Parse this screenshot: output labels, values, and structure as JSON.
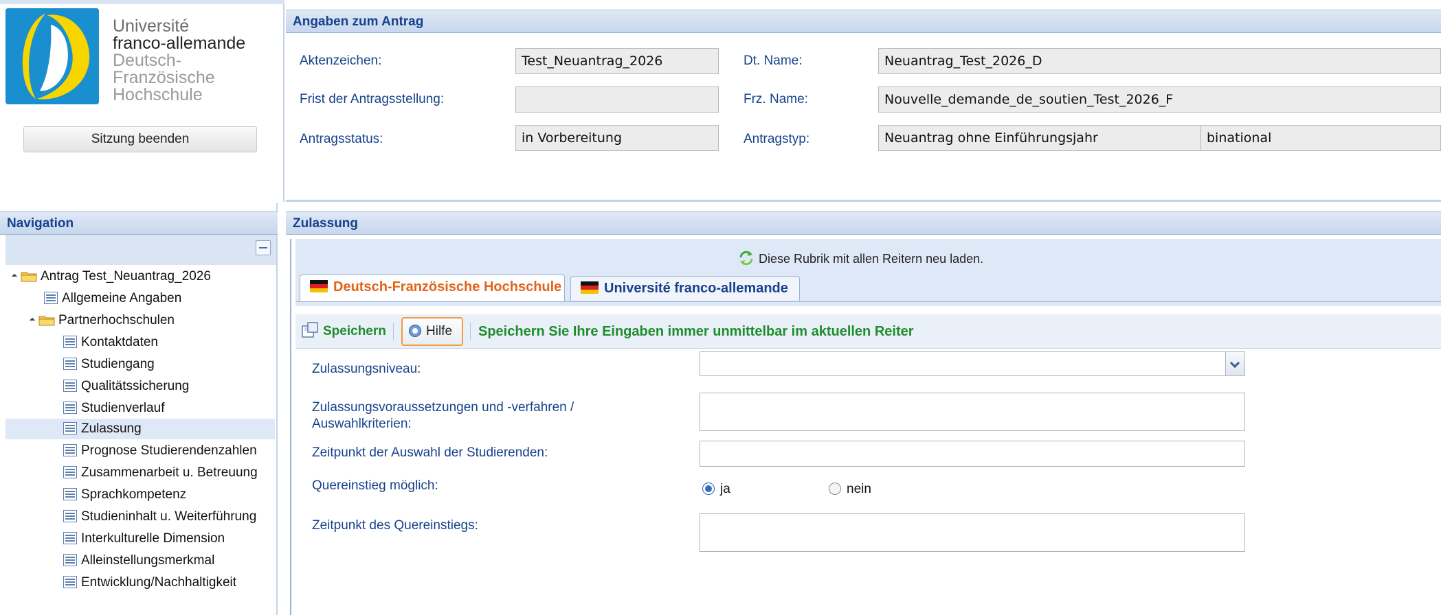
{
  "logo": {
    "line1": "Université",
    "line2": "franco-allemande",
    "line3": "Deutsch-Französische",
    "line4": "Hochschule"
  },
  "session": {
    "logout_label": "Sitzung beenden"
  },
  "antrag": {
    "header": "Angaben zum Antrag",
    "aktenzeichen_label": "Aktenzeichen:",
    "aktenzeichen_value": "Test_Neuantrag_2026",
    "frist_label": "Frist der Antragsstellung:",
    "frist_value": "",
    "status_label": "Antragsstatus:",
    "status_value": "in Vorbereitung",
    "dt_name_label": "Dt. Name:",
    "dt_name_value": "Neuantrag_Test_2026_D",
    "frz_name_label": "Frz. Name:",
    "frz_name_value": "Nouvelle_demande_de_soutien_Test_2026_F",
    "typ_label": "Antragstyp:",
    "typ_value": "Neuantrag ohne Einführungsjahr",
    "typ_value2": "binational"
  },
  "navigation": {
    "header": "Navigation",
    "root": "Antrag Test_Neuantrag_2026",
    "allgemein": "Allgemeine Angaben",
    "partner": "Partnerhochschulen",
    "items": [
      "Kontaktdaten",
      "Studiengang",
      "Qualitätssicherung",
      "Studienverlauf",
      "Zulassung",
      "Prognose Studierendenzahlen",
      "Zusammenarbeit u. Betreuung",
      "Sprachkompetenz",
      "Studieninhalt u. Weiterführung",
      "Interkulturelle Dimension",
      "Alleinstellungsmerkmal",
      "Entwicklung/Nachhaltigkeit"
    ],
    "selected": "Zulassung"
  },
  "zulassung": {
    "header": "Zulassung",
    "reload_text": "Diese Rubrik mit allen Reitern neu laden.",
    "tabs": [
      "Deutsch-Französische Hochschule",
      "Université franco-allemande"
    ],
    "save_label": "Speichern",
    "help_label": "Hilfe",
    "save_hint": "Speichern Sie Ihre Eingaben immer unmittelbar im aktuellen Reiter",
    "niveau_label": "Zulassungsniveau:",
    "niveau_value": "",
    "voraussetzungen_label_line1": "Zulassungsvoraussetzungen und -verfahren /",
    "voraussetzungen_label_line2": "Auswahlkriterien:",
    "zeitpunkt_label": "Zeitpunkt der Auswahl der Studierenden:",
    "quereinstieg_label": "Quereinstieg möglich:",
    "radio_ja": "ja",
    "radio_nein": "nein",
    "quereinstieg_selected": "ja",
    "zeitpunkt_quereinstieg_label": "Zeitpunkt des Quereinstiegs:"
  },
  "colors": {
    "header_text": "#15428b",
    "active_tab": "#e2641b",
    "save_green": "#1e8c2c",
    "help_border": "#f19a3e"
  }
}
